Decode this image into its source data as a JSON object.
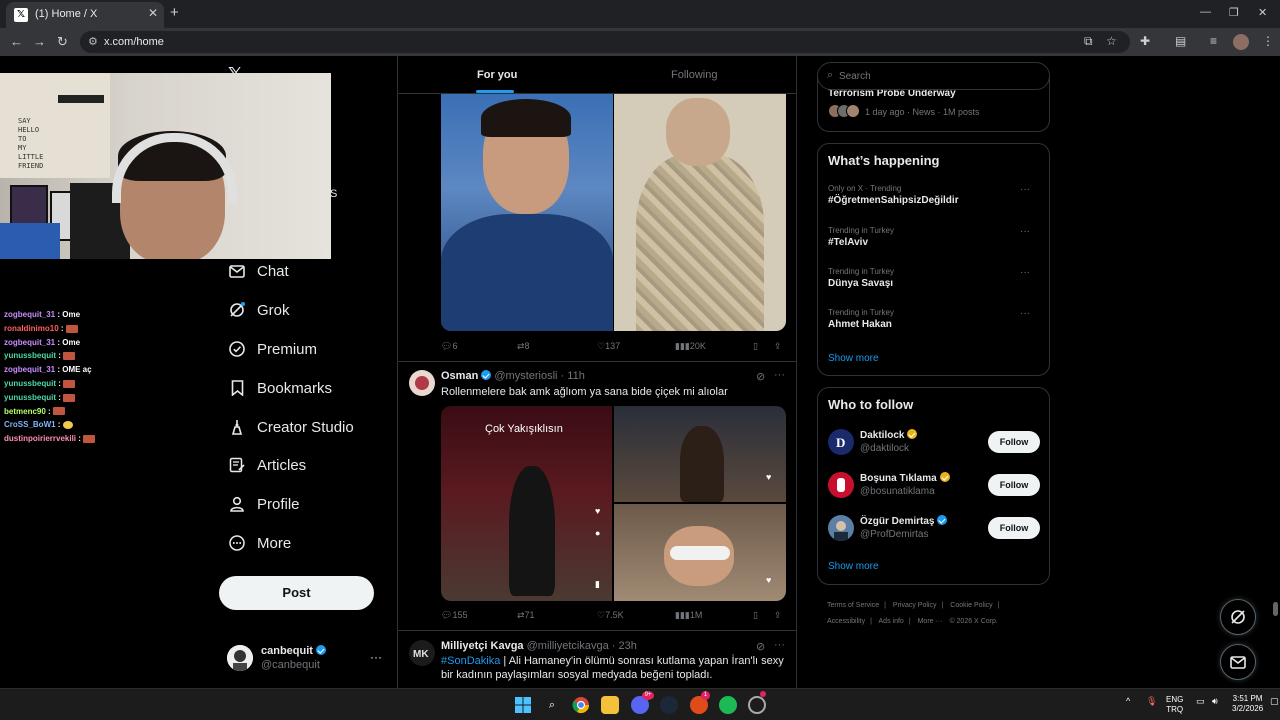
{
  "browser": {
    "tab_title": "(1) Home / X",
    "url": "x.com/home"
  },
  "stream": {
    "chat": [
      {
        "user": "zogbequit_31",
        "text": "Ome",
        "emote": false
      },
      {
        "user": "ronaldinimo10",
        "text": "",
        "emote": true
      },
      {
        "user": "zogbequit_31",
        "text": "Ome",
        "emote": false
      },
      {
        "user": "yunussbequit",
        "text": "",
        "emote": true
      },
      {
        "user": "zogbequit_31",
        "text": "OME aç",
        "emote": false
      },
      {
        "user": "yunussbequit",
        "text": "",
        "emote": true
      },
      {
        "user": "yunussbequit",
        "text": "",
        "emote": true
      },
      {
        "user": "betmenc90",
        "text": "",
        "emote": true
      },
      {
        "user": "CroSS_BoW1",
        "text": "",
        "emote": true
      },
      {
        "user": "dustinpoirierrvekili",
        "text": "",
        "emote": true
      }
    ],
    "poster_text": "SAY\nHELLO\nTO\nMY\nLITTLE\nFRIEND"
  },
  "nav": {
    "items": [
      {
        "label": "Chat",
        "icon": "mail-icon"
      },
      {
        "label": "Grok",
        "icon": "grok-icon"
      },
      {
        "label": "Premium",
        "icon": "x-badge-icon"
      },
      {
        "label": "Bookmarks",
        "icon": "bookmark-icon"
      },
      {
        "label": "Creator Studio",
        "icon": "creator-icon"
      },
      {
        "label": "Articles",
        "icon": "article-icon"
      },
      {
        "label": "Profile",
        "icon": "person-icon"
      },
      {
        "label": "More",
        "icon": "more-circle-icon"
      }
    ],
    "post_label": "Post",
    "partial_letter": "S",
    "account": {
      "name": "canbequit",
      "handle": "@canbequit"
    }
  },
  "timeline": {
    "tabs": {
      "for_you": "For you",
      "following": "Following"
    },
    "tweet1": {
      "replies": "6",
      "reposts": "8",
      "likes": "137",
      "views": "20K"
    },
    "tweet2": {
      "name": "Osman",
      "handle": "@mysteriosli",
      "time": "11h",
      "text": "Rollenmelere bak amk ağlıom ya sana bide çiçek mi alıolar",
      "image_caption": "Çok Yakışıklısın",
      "replies": "155",
      "reposts": "71",
      "likes": "7.5K",
      "views": "1M"
    },
    "tweet3": {
      "name": "Milliyetçi Kavga",
      "handle": "@milliyetcikavga",
      "time": "23h",
      "hashtag": "#SonDakika",
      "text": " | Ali Hamaney'in ölümü sonrası kutlama yapan İran'lı sexy bir kadının paylaşımları sosyal medyada beğeni topladı."
    }
  },
  "sidebar": {
    "search_placeholder": "Search",
    "news": {
      "title": "Terrorism Probe Underway",
      "meta": "1 day ago · News · 1M posts"
    },
    "happening": {
      "title": "What’s happening",
      "trends": [
        {
          "context": "Only on X · Trending",
          "name": "#ÖğretmenSahipsizDeğildir"
        },
        {
          "context": "Trending in Turkey",
          "name": "#TelAviv"
        },
        {
          "context": "Trending in Turkey",
          "name": "Dünya Savaşı"
        },
        {
          "context": "Trending in Turkey",
          "name": "Ahmet Hakan"
        }
      ],
      "show_more": "Show more"
    },
    "who_to_follow": {
      "title": "Who to follow",
      "accounts": [
        {
          "name": "Daktilock",
          "handle": "@daktilock",
          "badge": "gold"
        },
        {
          "name": "Boşuna Tıklama",
          "handle": "@bosunatiklama",
          "badge": "gold"
        },
        {
          "name": "Özgür Demirtaş",
          "handle": "@ProfDemirtas",
          "badge": "blue"
        }
      ],
      "follow_label": "Follow",
      "show_more": "Show more"
    },
    "footer": [
      "Terms of Service",
      "|",
      "Privacy Policy",
      "|",
      "Cookie Policy",
      "|",
      "Accessibility",
      "|",
      "Ads info",
      "|",
      "More ···",
      "© 2026 X Corp."
    ]
  },
  "taskbar": {
    "lang": "ENG",
    "lang2": "TRQ",
    "time": "3:51 PM",
    "date": "3/2/2026",
    "discord_badge": "9+",
    "notif_badge": "1"
  }
}
